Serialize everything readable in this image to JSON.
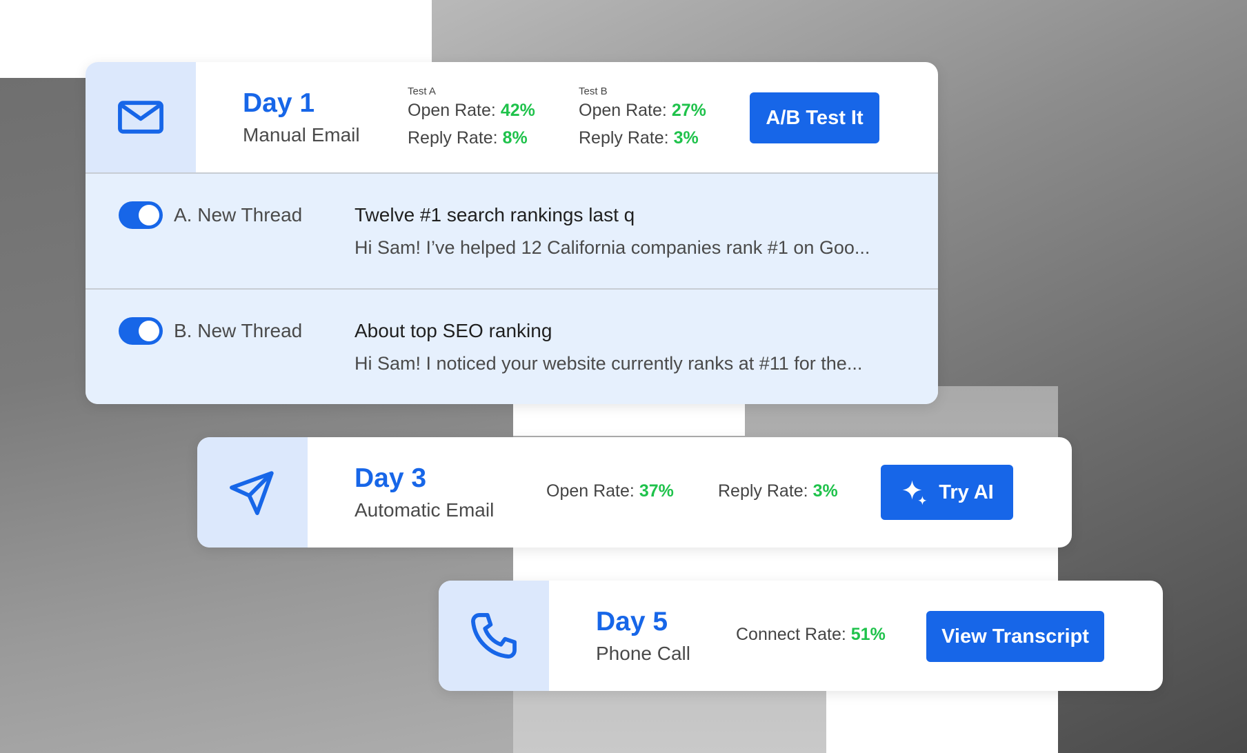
{
  "day1": {
    "title": "Day 1",
    "subtitle": "Manual Email",
    "icon": "envelope-icon",
    "test_a": {
      "label": "Test A",
      "open_label": "Open Rate:",
      "open_value": "42%",
      "reply_label": "Reply Rate:",
      "reply_value": "8%"
    },
    "test_b": {
      "label": "Test B",
      "open_label": "Open Rate:",
      "open_value": "27%",
      "reply_label": "Reply Rate:",
      "reply_value": "3%"
    },
    "button_label": "A/B Test It",
    "threads": [
      {
        "label": "A. New Thread",
        "enabled": true,
        "subject": "Twelve #1 search rankings last q",
        "preview": "Hi Sam! I’ve helped 12 California companies rank #1 on Goo..."
      },
      {
        "label": "B. New Thread",
        "enabled": true,
        "subject": "About top SEO ranking",
        "preview": "Hi Sam! I noticed your website currently ranks at #11 for the..."
      }
    ]
  },
  "day3": {
    "title": "Day 3",
    "subtitle": "Automatic Email",
    "icon": "send-icon",
    "open_label": "Open Rate:",
    "open_value": "37%",
    "reply_label": "Reply Rate:",
    "reply_value": "3%",
    "button_label": "Try AI",
    "button_icon": "sparkle-icon"
  },
  "day5": {
    "title": "Day 5",
    "subtitle": "Phone Call",
    "icon": "phone-icon",
    "connect_label": "Connect Rate:",
    "connect_value": "51%",
    "button_label": "View Transcript"
  },
  "colors": {
    "accent": "#1766e8",
    "success": "#1fc24b",
    "icon_bg": "#dce8fc",
    "thread_bg": "#e6f0fd"
  }
}
